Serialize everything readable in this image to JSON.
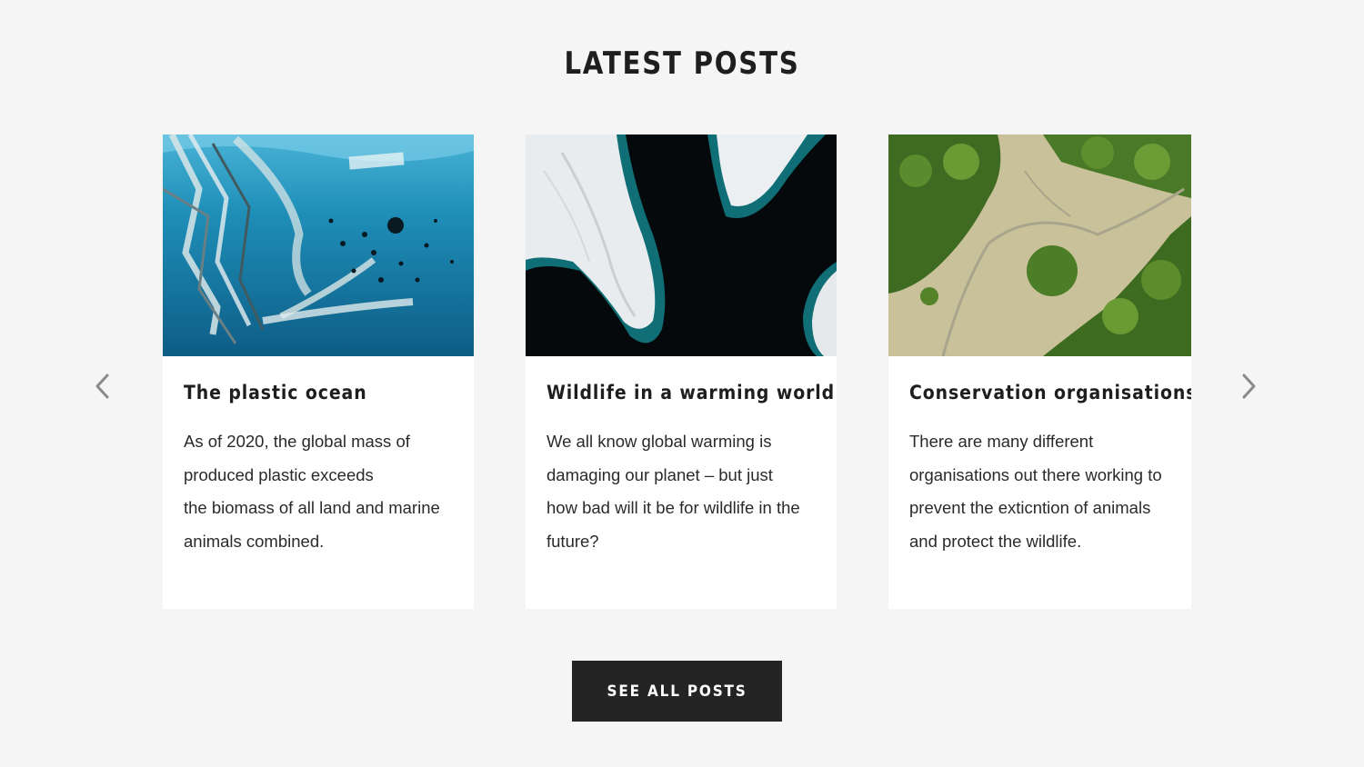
{
  "section": {
    "title": "LATEST POSTS"
  },
  "posts": [
    {
      "title": "The plastic ocean",
      "excerpt_lines": [
        "As of 2020, the global mass of",
        "produced plastic exceeds",
        "the biomass of all land and marine",
        "animals combined."
      ],
      "image_icon": "plastic-ocean-image"
    },
    {
      "title": "Wildlife in a warming world",
      "excerpt_lines": [
        "We all know global warming is",
        "damaging our planet – but just",
        "how bad will it be for wildlife in the",
        "future?"
      ],
      "image_icon": "ice-aerial-image"
    },
    {
      "title": "Conservation organisations",
      "excerpt_lines": [
        "There are many different",
        "organisations out there working to",
        "prevent the exticntion of animals",
        "and protect the wildlife."
      ],
      "image_icon": "forest-aerial-image"
    }
  ],
  "carousel": {
    "prev_icon": "chevron-left-icon",
    "next_icon": "chevron-right-icon"
  },
  "cta": {
    "label": "SEE ALL POSTS"
  },
  "colors": {
    "background": "#f5f5f5",
    "card": "#ffffff",
    "button": "#242424",
    "text": "#1e1e1e",
    "arrow": "#8a8a8a"
  }
}
